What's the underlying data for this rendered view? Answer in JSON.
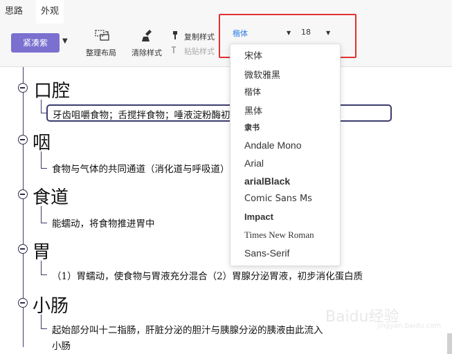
{
  "tabs": [
    {
      "label": "思路"
    },
    {
      "label": "外观"
    }
  ],
  "toolbar": {
    "theme_label": "紧凑紫",
    "layout_label": "整理布局",
    "clear_style_label": "清除样式",
    "copy_style_label": "复制样式",
    "paste_style_label": "粘贴样式",
    "font_value": "楷体",
    "font_size_value": "18"
  },
  "font_menu": {
    "items": [
      "宋体",
      "微软雅黑",
      "楷体",
      "黑体",
      "隶书",
      "Andale Mono",
      "Arial",
      "arialBlack",
      "Comic Sans Ms",
      "Impact",
      "Times New Roman",
      "Sans-Serif"
    ]
  },
  "mindmap": {
    "topics": [
      {
        "title": "口腔",
        "sub": "牙齿咀嚼食物；舌搅拌食物；唾液淀粉酶初步消化淀粉"
      },
      {
        "title": "咽",
        "sub": "食物与气体的共同通道（消化道与呼吸道）"
      },
      {
        "title": "食道",
        "sub": "能蠕动，将食物推进胃中"
      },
      {
        "title": "胃",
        "sub": "（1）胃蠕动，使食物与胃液充分混合（2）胃腺分泌胃液，初步消化蛋白质"
      },
      {
        "title": "小肠",
        "sub": "起始部分叫十二指肠，肝脏分泌的胆汁与胰腺分泌的胰液由此流入"
      }
    ],
    "trailing_text": "小肠"
  },
  "watermark": {
    "text": "Baidu经验",
    "sub": "jingyan.baidu.com"
  },
  "colors": {
    "accent": "#7b6fd0",
    "highlight": "#e03131",
    "node_line": "#3b3b6e",
    "font_active": "#2b7de9"
  }
}
